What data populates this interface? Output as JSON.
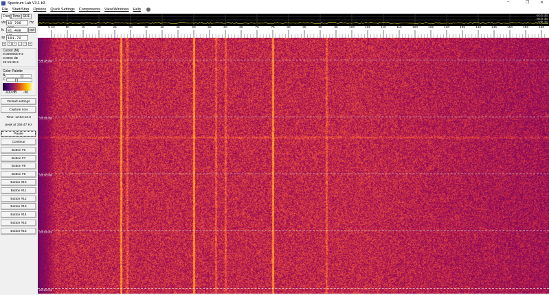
{
  "window": {
    "title": "Spectrum Lab V3.1 b3",
    "minimize": "–",
    "restore": "❐",
    "close": "✕"
  },
  "menu": [
    "File",
    "Start/Stop",
    "Options",
    "Quick Settings",
    "Components",
    "View/Windows",
    "Help"
  ],
  "left": {
    "tabs": [
      "Freq",
      "Time",
      "RDF"
    ],
    "vfo": {
      "label": "vfo",
      "value": "10 700 000",
      "unit": "Hz"
    },
    "fc": {
      "label": "fc",
      "value": "81.408 Hz",
      "opt": "opt"
    },
    "sp": {
      "label": "sp",
      "value": "161.72 Hz"
    },
    "step_buttons": [
      "«",
      "‹",
      "‹",
      "-",
      "›",
      "»"
    ],
    "cursor": {
      "title": "Cursor [M]",
      "freq": "0.0000000 Hz",
      "level": "0.0000 dB",
      "time": "23:19:49.3"
    },
    "palette": {
      "title": "Color Palette",
      "b": "B",
      "c": "C",
      "min": "-100 dB",
      "max": "-50",
      "brightness": 0.6,
      "contrast": 0.35
    },
    "buttons": [
      "Default settings",
      "Capture now",
      "Time:  12:54:12.3",
      "peak at 346.47 Hz",
      "Pause",
      "Continue",
      "Button #6",
      "Button #7",
      "Button #8",
      "Button #9",
      "Button #10",
      "Button #11",
      "Button #12",
      "Button #13",
      "Button #14",
      "Button #15",
      "Button #16"
    ]
  },
  "spectrum": {
    "db_labels": [
      "-60.0 dB",
      "-80.0 dB",
      "-100 dB"
    ]
  },
  "freq_axis": {
    "first": "5 Hz",
    "ticks": [
      "10",
      "15",
      "20",
      "25",
      "30",
      "35",
      "40",
      "45",
      "50",
      "55",
      "60",
      "65",
      "70",
      "75",
      "80",
      "85",
      "90",
      "95",
      "100",
      "105",
      "110",
      "115",
      "120",
      "125",
      "130",
      "135",
      "140",
      "145",
      "150",
      "155",
      "160"
    ]
  },
  "waterfall": {
    "times": [
      "23:40:08",
      "23:35:08",
      "23:30:08",
      "23:25:01",
      "23:20:01"
    ],
    "lines_hz": [
      27,
      50,
      75,
      29,
      57,
      92,
      60
    ]
  },
  "colors": {
    "accent": "#f0a020",
    "bg": "#6a2a6a"
  }
}
